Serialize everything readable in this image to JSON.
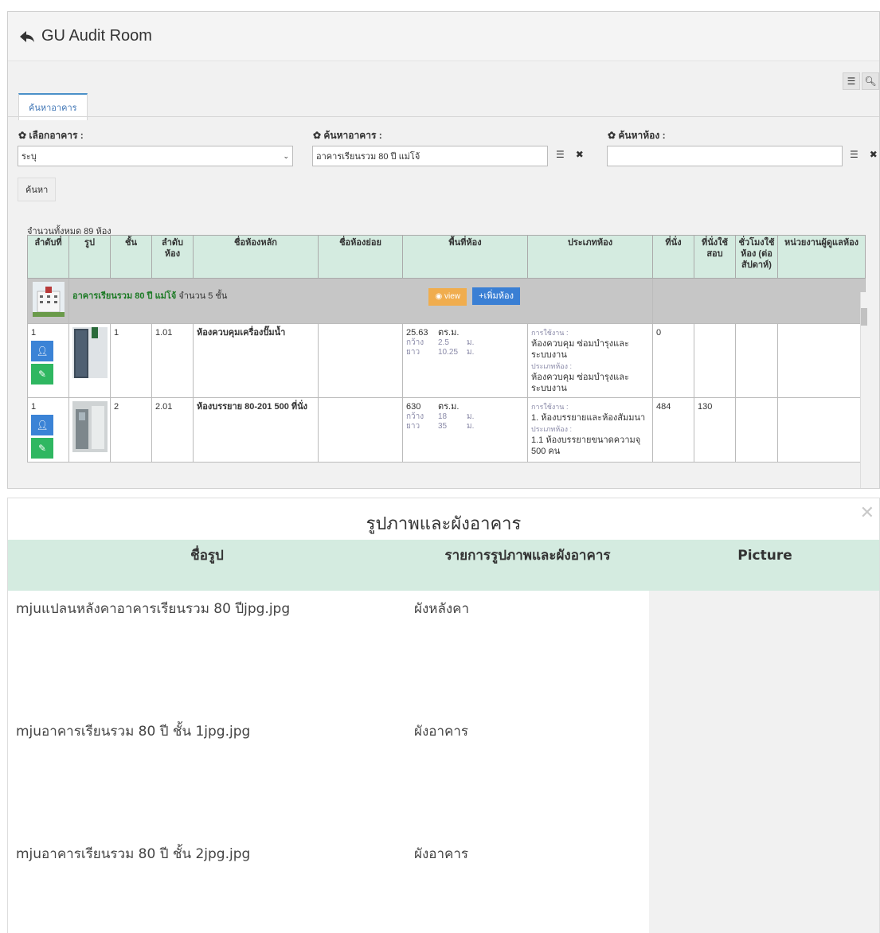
{
  "app": {
    "title": "GU Audit Room"
  },
  "tabs": [
    {
      "label": "ค้นหาอาคาร"
    }
  ],
  "filters": {
    "select_building": {
      "label": "เลือกอาคาร :",
      "value": "ระบุ"
    },
    "search_building": {
      "label": "ค้นหาอาคาร :",
      "value": "อาคารเรียนรวม 80 ปี แม่โจ้"
    },
    "search_room": {
      "label": "ค้นหาห้อง :",
      "value": ""
    },
    "search_button": "ค้นหา"
  },
  "total": "จำนวนทั้งหมด 89 ห้อง",
  "table": {
    "headers": [
      "ลำดับที่",
      "รูป",
      "ชั้น",
      "ลำดับห้อง",
      "ชื่อห้องหลัก",
      "ชื่อห้องย่อย",
      "พื้นที่ห้อง",
      "ประเภทห้อง",
      "ที่นั่ง",
      "ที่นั่งใช้สอบ",
      "ชั่วโมงใช้ห้อง (ต่อสัปดาห์)",
      "หน่วยงานผู้ดูแลห้อง"
    ],
    "group": {
      "name": "อาคารเรียนรวม 80 ปี แม่โจ้",
      "floors": "จำนวน 5 ชั้น",
      "view_label": "view",
      "add_label": "+เพิ่มห้อง"
    },
    "rows": [
      {
        "no": "1",
        "floor": "1",
        "room_no": "1.01",
        "main_name": "ห้องควบคุมเครื่องปั๊มน้ำ",
        "sub_name": "",
        "area": "25.63",
        "area_unit": "ตร.ม.",
        "width_label": "กว้าง",
        "width": "2.5",
        "width_unit": "ม.",
        "length_label": "ยาว",
        "length": "10.25",
        "length_unit": "ม.",
        "usage_label": "การใช้งาน :",
        "usage": "ห้องควบคุม ซ่อมบำรุงและระบบงาน",
        "type_label": "ประเภทห้อง :",
        "type": "ห้องควบคุม ซ่อมบำรุงและระบบงาน",
        "seats": "0",
        "exam_seats": "",
        "hours": "",
        "owner": ""
      },
      {
        "no": "1",
        "floor": "2",
        "room_no": "2.01",
        "main_name": "ห้องบรรยาย 80-201 500 ที่นั่ง",
        "sub_name": "",
        "area": "630",
        "area_unit": "ตร.ม.",
        "width_label": "กว้าง",
        "width": "18",
        "width_unit": "ม.",
        "length_label": "ยาว",
        "length": "35",
        "length_unit": "ม.",
        "usage_label": "การใช้งาน :",
        "usage": "1. ห้องบรรยายและห้องสัมมนา",
        "type_label": "ประเภทห้อง :",
        "type": "1.1 ห้องบรรยายขนาดความจุ 500 คน",
        "seats": "484",
        "exam_seats": "130",
        "hours": "",
        "owner": ""
      }
    ]
  },
  "modal": {
    "title": "รูปภาพและผังอาคาร",
    "headers": [
      "ชื่อรูป",
      "รายการรูปภาพและผังอาคาร",
      "Picture"
    ],
    "rows": [
      {
        "name": "mjuแปลนหลังคาอาคารเรียนรวม 80 ปีjpg.jpg",
        "kind": "ผังหลังคา"
      },
      {
        "name": "mjuอาคารเรียนรวม 80 ปี ชั้น 1jpg.jpg",
        "kind": "ผังอาคาร"
      },
      {
        "name": "mjuอาคารเรียนรวม 80 ปี ชั้น 2jpg.jpg",
        "kind": "ผังอาคาร"
      }
    ]
  },
  "icons": [
    "back-arrow-icon",
    "list-icon",
    "search-icon",
    "gear-icon",
    "chevron-down-icon",
    "clear-icon",
    "eye-icon",
    "user-icon",
    "edit-icon",
    "close-icon"
  ],
  "colors": {
    "header_green": "#d4ebe0",
    "group_green_text": "#1c7a25",
    "view_orange": "#f0ad4e",
    "add_blue": "#3a7fd4",
    "user_blue": "#3b83d6",
    "edit_green": "#2fb761"
  }
}
